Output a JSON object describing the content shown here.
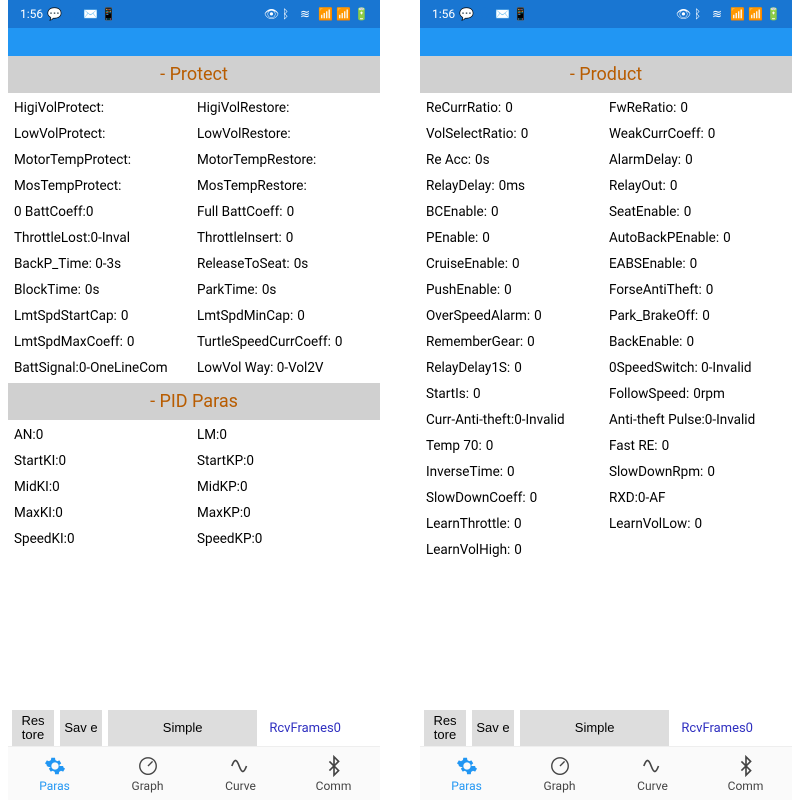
{
  "status": {
    "time": "1:56",
    "left_icons": [
      "chat-icon",
      "avatar-icon",
      "mail-icon",
      "app-icon",
      "more-icon"
    ],
    "right_icons": [
      "eye-icon",
      "bluetooth-icon",
      "wifi-icon",
      "signal1-icon",
      "signal2-icon",
      "battery-icon"
    ]
  },
  "left": {
    "sections": [
      {
        "title": "- Protect",
        "rows": [
          {
            "l": {
              "label": "HigiVolProtect:",
              "value": ""
            },
            "r": {
              "label": "HigiVolRestore:",
              "value": ""
            }
          },
          {
            "l": {
              "label": "LowVolProtect:",
              "value": ""
            },
            "r": {
              "label": "LowVolRestore:",
              "value": ""
            }
          },
          {
            "l": {
              "label": "MotorTempProtect:",
              "value": ""
            },
            "r": {
              "label": "MotorTempRestore:",
              "value": ""
            }
          },
          {
            "l": {
              "label": "MosTempProtect:",
              "value": ""
            },
            "r": {
              "label": "MosTempRestore:",
              "value": ""
            }
          },
          {
            "l": {
              "label": "0 BattCoeff:0",
              "value": ""
            },
            "r": {
              "label": "Full BattCoeff:",
              "value": "0"
            }
          },
          {
            "l": {
              "label": "ThrottleLost:0-Inval",
              "value": ""
            },
            "r": {
              "label": "ThrottleInsert:",
              "value": "0"
            }
          },
          {
            "l": {
              "label": "BackP_Time: 0-3s",
              "value": ""
            },
            "r": {
              "label": "ReleaseToSeat:",
              "value": "0s"
            }
          },
          {
            "l": {
              "label": "BlockTime:",
              "value": "0s"
            },
            "r": {
              "label": "ParkTime:",
              "value": "0s"
            }
          },
          {
            "l": {
              "label": "LmtSpdStartCap:",
              "value": "0"
            },
            "r": {
              "label": "LmtSpdMinCap:",
              "value": "0"
            }
          },
          {
            "l": {
              "label": "LmtSpdMaxCoeff:",
              "value": "0"
            },
            "r": {
              "label": "TurtleSpeedCurrCoeff:",
              "value": "0"
            }
          },
          {
            "l": {
              "label": "BattSignal:0-OneLineCom",
              "value": ""
            },
            "r": {
              "label": "LowVol Way: 0-Vol2V",
              "value": ""
            }
          }
        ]
      },
      {
        "title": "- PID Paras",
        "rows": [
          {
            "l": {
              "label": "AN:0",
              "value": ""
            },
            "r": {
              "label": "LM:0",
              "value": ""
            }
          },
          {
            "l": {
              "label": "StartKI:0",
              "value": ""
            },
            "r": {
              "label": "StartKP:0",
              "value": ""
            }
          },
          {
            "l": {
              "label": "MidKI:0",
              "value": ""
            },
            "r": {
              "label": "MidKP:0",
              "value": ""
            }
          },
          {
            "l": {
              "label": "MaxKI:0",
              "value": ""
            },
            "r": {
              "label": "MaxKP:0",
              "value": ""
            }
          },
          {
            "l": {
              "label": "SpeedKI:0",
              "value": ""
            },
            "r": {
              "label": "SpeedKP:0",
              "value": ""
            }
          }
        ]
      }
    ]
  },
  "right": {
    "sections": [
      {
        "title": "- Product",
        "rows": [
          {
            "l": {
              "label": "ReCurrRatio:",
              "value": "0"
            },
            "r": {
              "label": "FwReRatio:",
              "value": "0"
            }
          },
          {
            "l": {
              "label": "VolSelectRatio:",
              "value": "0"
            },
            "r": {
              "label": "WeakCurrCoeff:",
              "value": "0"
            }
          },
          {
            "l": {
              "label": "Re Acc:",
              "value": "0s"
            },
            "r": {
              "label": "AlarmDelay:",
              "value": "0"
            }
          },
          {
            "l": {
              "label": "RelayDelay:",
              "value": "0ms"
            },
            "r": {
              "label": "RelayOut:",
              "value": "0"
            }
          },
          {
            "l": {
              "label": "BCEnable:",
              "value": "0"
            },
            "r": {
              "label": "SeatEnable:",
              "value": "0"
            }
          },
          {
            "l": {
              "label": "PEnable:",
              "value": "0"
            },
            "r": {
              "label": "AutoBackPEnable:",
              "value": "0"
            }
          },
          {
            "l": {
              "label": "CruiseEnable:",
              "value": "0"
            },
            "r": {
              "label": "EABSEnable:",
              "value": "0"
            }
          },
          {
            "l": {
              "label": "PushEnable:",
              "value": "0"
            },
            "r": {
              "label": "ForseAntiTheft:",
              "value": "0"
            }
          },
          {
            "l": {
              "label": "OverSpeedAlarm:",
              "value": "0"
            },
            "r": {
              "label": "Park_BrakeOff:",
              "value": "0"
            }
          },
          {
            "l": {
              "label": "RememberGear:",
              "value": "0"
            },
            "r": {
              "label": "BackEnable:",
              "value": "0"
            }
          },
          {
            "l": {
              "label": "RelayDelay1S:",
              "value": "0"
            },
            "r": {
              "label": "0SpeedSwitch: 0-Invalid",
              "value": ""
            }
          },
          {
            "l": {
              "label": "StartIs:",
              "value": "0"
            },
            "r": {
              "label": "FollowSpeed:",
              "value": "0rpm"
            }
          },
          {
            "l": {
              "label": "Curr-Anti-theft:0-Invalid",
              "value": ""
            },
            "r": {
              "label": "Anti-theft Pulse:0-Invalid",
              "value": ""
            }
          },
          {
            "l": {
              "label": "Temp 70:",
              "value": "0"
            },
            "r": {
              "label": "Fast RE:",
              "value": "0"
            }
          },
          {
            "l": {
              "label": "InverseTime:",
              "value": "0"
            },
            "r": {
              "label": "SlowDownRpm:",
              "value": "0"
            }
          },
          {
            "l": {
              "label": "SlowDownCoeff:",
              "value": "0"
            },
            "r": {
              "label": "RXD:0-AF",
              "value": ""
            }
          },
          {
            "l": {
              "label": "LearnThrottle:",
              "value": "0"
            },
            "r": {
              "label": "LearnVolLow:",
              "value": "0"
            }
          },
          {
            "l": {
              "label": "LearnVolHigh:",
              "value": "0"
            },
            "r": {
              "label": "",
              "value": ""
            }
          }
        ]
      }
    ]
  },
  "actions": {
    "restore": "Res\ntore",
    "save": "Sav\ne",
    "simple": "Simple",
    "rcv": "RcvFrames0"
  },
  "nav": {
    "items": [
      {
        "label": "Paras",
        "icon": "gear-icon",
        "active": true
      },
      {
        "label": "Graph",
        "icon": "gauge-icon",
        "active": false
      },
      {
        "label": "Curve",
        "icon": "wave-icon",
        "active": false
      },
      {
        "label": "Comm",
        "icon": "bluetooth-icon",
        "active": false
      }
    ]
  }
}
